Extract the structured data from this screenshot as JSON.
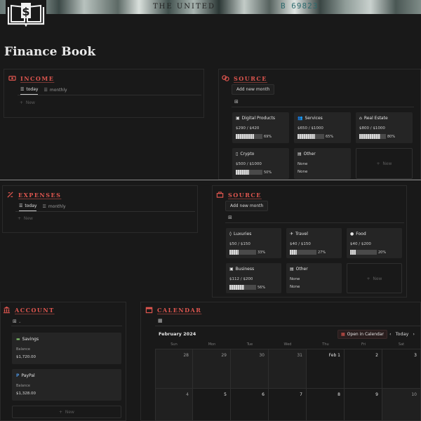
{
  "page": {
    "title": "Finance Book"
  },
  "banner": {
    "serial": "B 69823",
    "word": "THE UNITED"
  },
  "income": {
    "title": "INCOME",
    "tabs": [
      {
        "label": "today"
      },
      {
        "label": "monthly"
      }
    ],
    "new_label": "New",
    "source": {
      "title": "SOURCE",
      "add_label": "Add new month",
      "cards": [
        {
          "title": "Digital Products",
          "amount": "$290 / $420",
          "percent_text": "69%",
          "progress": 0.69
        },
        {
          "title": "Services",
          "amount": "$650 / $1000",
          "percent_text": "65%",
          "progress": 0.65
        },
        {
          "title": "Real Estate",
          "amount": "$800 / $1000",
          "percent_text": "80%",
          "progress": 0.8
        },
        {
          "title": "Crypto",
          "amount": "$500 / $1000",
          "percent_text": "50%",
          "progress": 0.5
        },
        {
          "title": "Other",
          "line1": "None",
          "line2": "None"
        }
      ],
      "new_label": "New"
    }
  },
  "expenses": {
    "title": "EXPENSES",
    "tabs": [
      {
        "label": "today"
      },
      {
        "label": "monthly"
      }
    ],
    "new_label": "New",
    "source": {
      "title": "SOURCE",
      "add_label": "Add new month",
      "cards": [
        {
          "title": "Luxuries",
          "amount": "$50 / $150",
          "percent_text": "33%",
          "progress": 0.33
        },
        {
          "title": "Travel",
          "amount": "$40 / $150",
          "percent_text": "27%",
          "progress": 0.27
        },
        {
          "title": "Food",
          "amount": "$40 / $200",
          "percent_text": "20%",
          "progress": 0.2
        },
        {
          "title": "Business",
          "amount": "$112 / $200",
          "percent_text": "56%",
          "progress": 0.56
        },
        {
          "title": "Other",
          "line1": "None",
          "line2": "None"
        }
      ],
      "new_label": "New"
    }
  },
  "account": {
    "title": "ACCOUNT",
    "cards": [
      {
        "title": "Savings",
        "label": "Balance",
        "value": "$1,720.00"
      },
      {
        "title": "PayPal",
        "label": "Balance",
        "value": "$1,328.00"
      }
    ],
    "new_label": "New"
  },
  "calendar": {
    "title": "CALENDAR",
    "month": "February 2024",
    "open_label": "Open in Calendar",
    "today_label": "Today",
    "weekdays": [
      "Sun",
      "Mon",
      "Tue",
      "Wed",
      "Thu",
      "Fri",
      "Sat"
    ],
    "week1": [
      "28",
      "29",
      "30",
      "31",
      "Feb 1",
      "2",
      "3"
    ],
    "week2": [
      "4",
      "5",
      "6",
      "7",
      "8",
      "9",
      "10"
    ]
  },
  "colors": {
    "accent": "#e0564f",
    "background": "#191919",
    "card": "#252525"
  }
}
